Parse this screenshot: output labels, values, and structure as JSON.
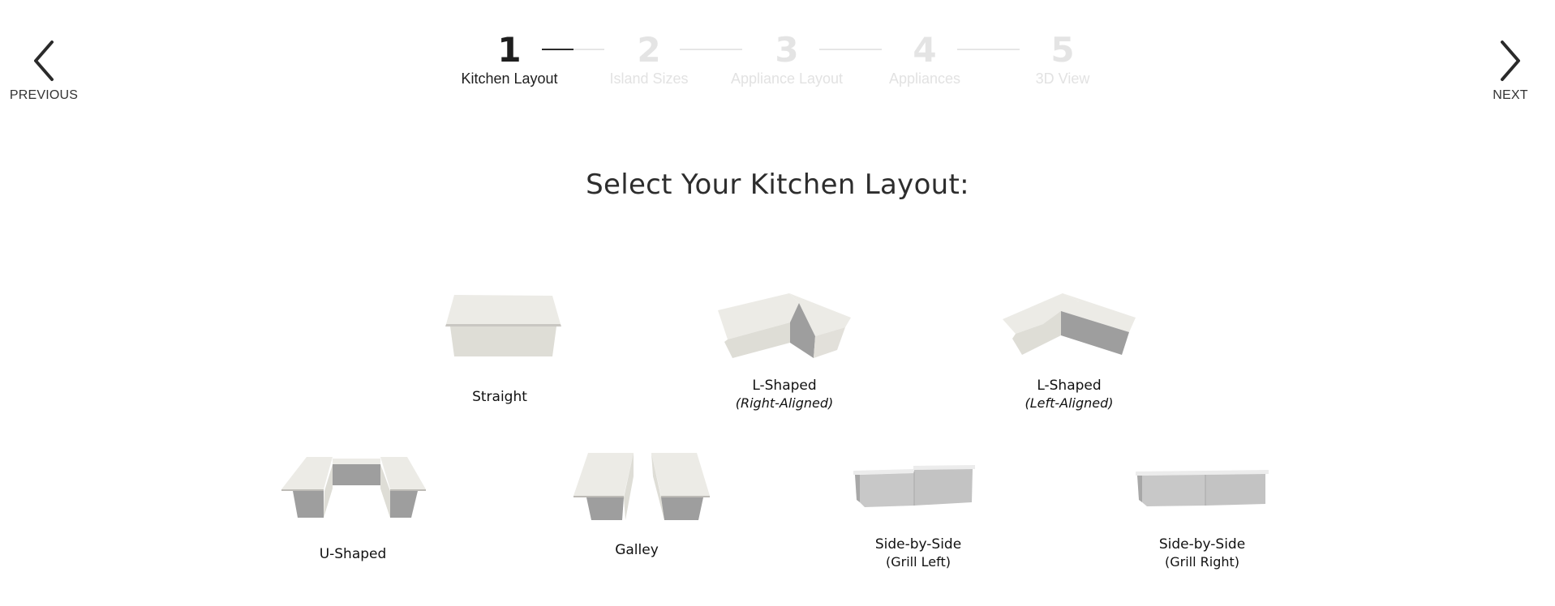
{
  "nav": {
    "previous_label": "PREVIOUS",
    "next_label": "NEXT"
  },
  "stepper": {
    "current_step": 1,
    "connector_progress": [
      0.5,
      0,
      0,
      0
    ],
    "steps": [
      {
        "number": "1",
        "label": "Kitchen Layout",
        "state": "active"
      },
      {
        "number": "2",
        "label": "Island Sizes",
        "state": "inactive"
      },
      {
        "number": "3",
        "label": "Appliance Layout",
        "state": "inactive"
      },
      {
        "number": "4",
        "label": "Appliances",
        "state": "inactive"
      },
      {
        "number": "5",
        "label": "3D View",
        "state": "inactive"
      }
    ]
  },
  "page": {
    "title": "Select Your Kitchen Layout:"
  },
  "layouts": [
    {
      "id": "straight",
      "icon": "straight-island-icon",
      "label": "Straight",
      "sublabel": ""
    },
    {
      "id": "l-right",
      "icon": "l-shaped-right-icon",
      "label": "L-Shaped",
      "sublabel": "(Right-Aligned)"
    },
    {
      "id": "l-left",
      "icon": "l-shaped-left-icon",
      "label": "L-Shaped",
      "sublabel": "(Left-Aligned)"
    },
    {
      "id": "u-shaped",
      "icon": "u-shaped-icon",
      "label": "U-Shaped",
      "sublabel": ""
    },
    {
      "id": "galley",
      "icon": "galley-icon",
      "label": "Galley",
      "sublabel": ""
    },
    {
      "id": "sbs-grill-left",
      "icon": "side-by-side-grill-left-icon",
      "label": "Side-by-Side",
      "sublabel": "(Grill Left)"
    },
    {
      "id": "sbs-grill-right",
      "icon": "side-by-side-grill-right-icon",
      "label": "Side-by-Side",
      "sublabel": "(Grill Right)"
    }
  ],
  "colors": {
    "active": "#1e1e1e",
    "inactive": "#e4e4e4",
    "countertop": "#ecebe7",
    "cabinet_light": "#dedbd5",
    "cabinet_dark": "#9c9c9c",
    "grill_body": "#c9c9c9"
  }
}
